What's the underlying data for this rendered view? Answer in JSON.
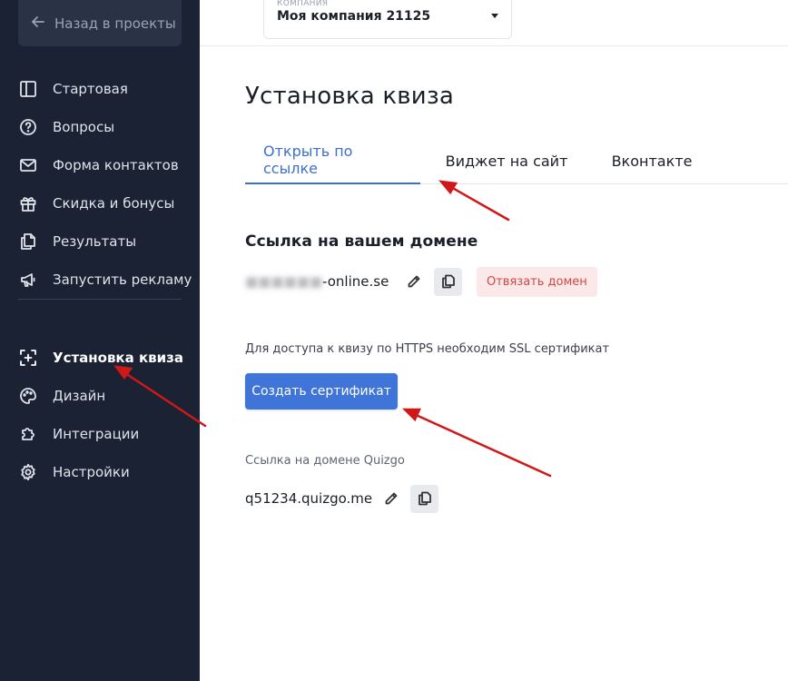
{
  "sidebar": {
    "back_label": "Назад в проекты",
    "items": [
      {
        "label": "Стартовая",
        "icon": "panel-icon"
      },
      {
        "label": "Вопросы",
        "icon": "question-icon"
      },
      {
        "label": "Форма контактов",
        "icon": "mail-icon"
      },
      {
        "label": "Скидка и бонусы",
        "icon": "gift-icon"
      },
      {
        "label": "Результаты",
        "icon": "copy-icon"
      },
      {
        "label": "Запустить рекламу",
        "icon": "megaphone-icon"
      }
    ],
    "items2": [
      {
        "label": "Установка квиза",
        "icon": "install-icon",
        "active": true
      },
      {
        "label": "Дизайн",
        "icon": "palette-icon"
      },
      {
        "label": "Интеграции",
        "icon": "puzzle-icon"
      },
      {
        "label": "Настройки",
        "icon": "gear-icon"
      }
    ]
  },
  "topbar": {
    "company_label": "КОМПАНИЯ",
    "company_value": "Моя компания 21125"
  },
  "main": {
    "title": "Установка квиза",
    "tabs": [
      {
        "label": "Открыть по ссылке",
        "active": true
      },
      {
        "label": "Виджет на сайт"
      },
      {
        "label": "Вконтакте"
      }
    ],
    "domain_heading": "Ссылка на вашем домене",
    "domain_value_visible": "-online.se",
    "unbind_label": "Отвязать домен",
    "ssl_note": "Для доступа к квизу по HTTPS необходим SSL сертификат",
    "create_cert_label": "Создать сертификат",
    "quizgo_label": "Ссылка на домене Quizgo",
    "quizgo_value": "q51234.quizgo.me"
  },
  "colors": {
    "sidebar_bg": "#1a2234",
    "accent": "#3d6fd1",
    "button_primary": "#3f74d8",
    "danger_bg": "#fbe9e9",
    "danger_text": "#d04848",
    "annotation_arrow": "#d01818"
  }
}
